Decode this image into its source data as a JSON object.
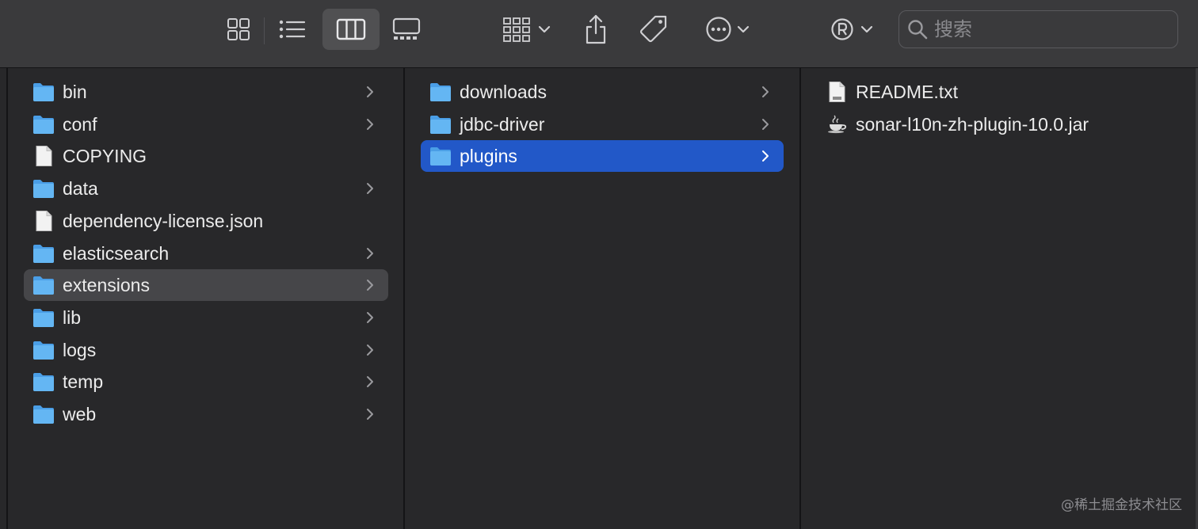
{
  "toolbar": {
    "view_buttons": [
      {
        "icon": "icon-view-grid-icon",
        "active": false
      },
      {
        "icon": "list-view-icon",
        "active": false
      },
      {
        "icon": "column-view-icon",
        "active": true
      },
      {
        "icon": "gallery-view-icon",
        "active": false
      }
    ],
    "search": {
      "placeholder": "搜索",
      "value": ""
    }
  },
  "columns": [
    {
      "items": [
        {
          "name": "bin",
          "kind": "folder",
          "has_children": true
        },
        {
          "name": "conf",
          "kind": "folder",
          "has_children": true
        },
        {
          "name": "COPYING",
          "kind": "file",
          "has_children": false
        },
        {
          "name": "data",
          "kind": "folder",
          "has_children": true
        },
        {
          "name": "dependency-license.json",
          "kind": "file",
          "has_children": false
        },
        {
          "name": "elasticsearch",
          "kind": "folder",
          "has_children": true
        },
        {
          "name": "extensions",
          "kind": "folder",
          "has_children": true,
          "selected": "inactive"
        },
        {
          "name": "lib",
          "kind": "folder",
          "has_children": true
        },
        {
          "name": "logs",
          "kind": "folder",
          "has_children": true
        },
        {
          "name": "temp",
          "kind": "folder",
          "has_children": true
        },
        {
          "name": "web",
          "kind": "folder",
          "has_children": true
        }
      ]
    },
    {
      "items": [
        {
          "name": "downloads",
          "kind": "folder",
          "has_children": true
        },
        {
          "name": "jdbc-driver",
          "kind": "folder",
          "has_children": true
        },
        {
          "name": "plugins",
          "kind": "folder",
          "has_children": true,
          "selected": "active"
        }
      ]
    },
    {
      "items": [
        {
          "name": "README.txt",
          "kind": "txt",
          "has_children": false
        },
        {
          "name": "sonar-l10n-zh-plugin-10.0.jar",
          "kind": "jar",
          "has_children": false
        }
      ]
    }
  ],
  "watermark": "@稀土掘金技术社区",
  "colors": {
    "selection_active": "#2258c8",
    "selection_inactive": "#464649",
    "folder": "#5fb2f0"
  }
}
